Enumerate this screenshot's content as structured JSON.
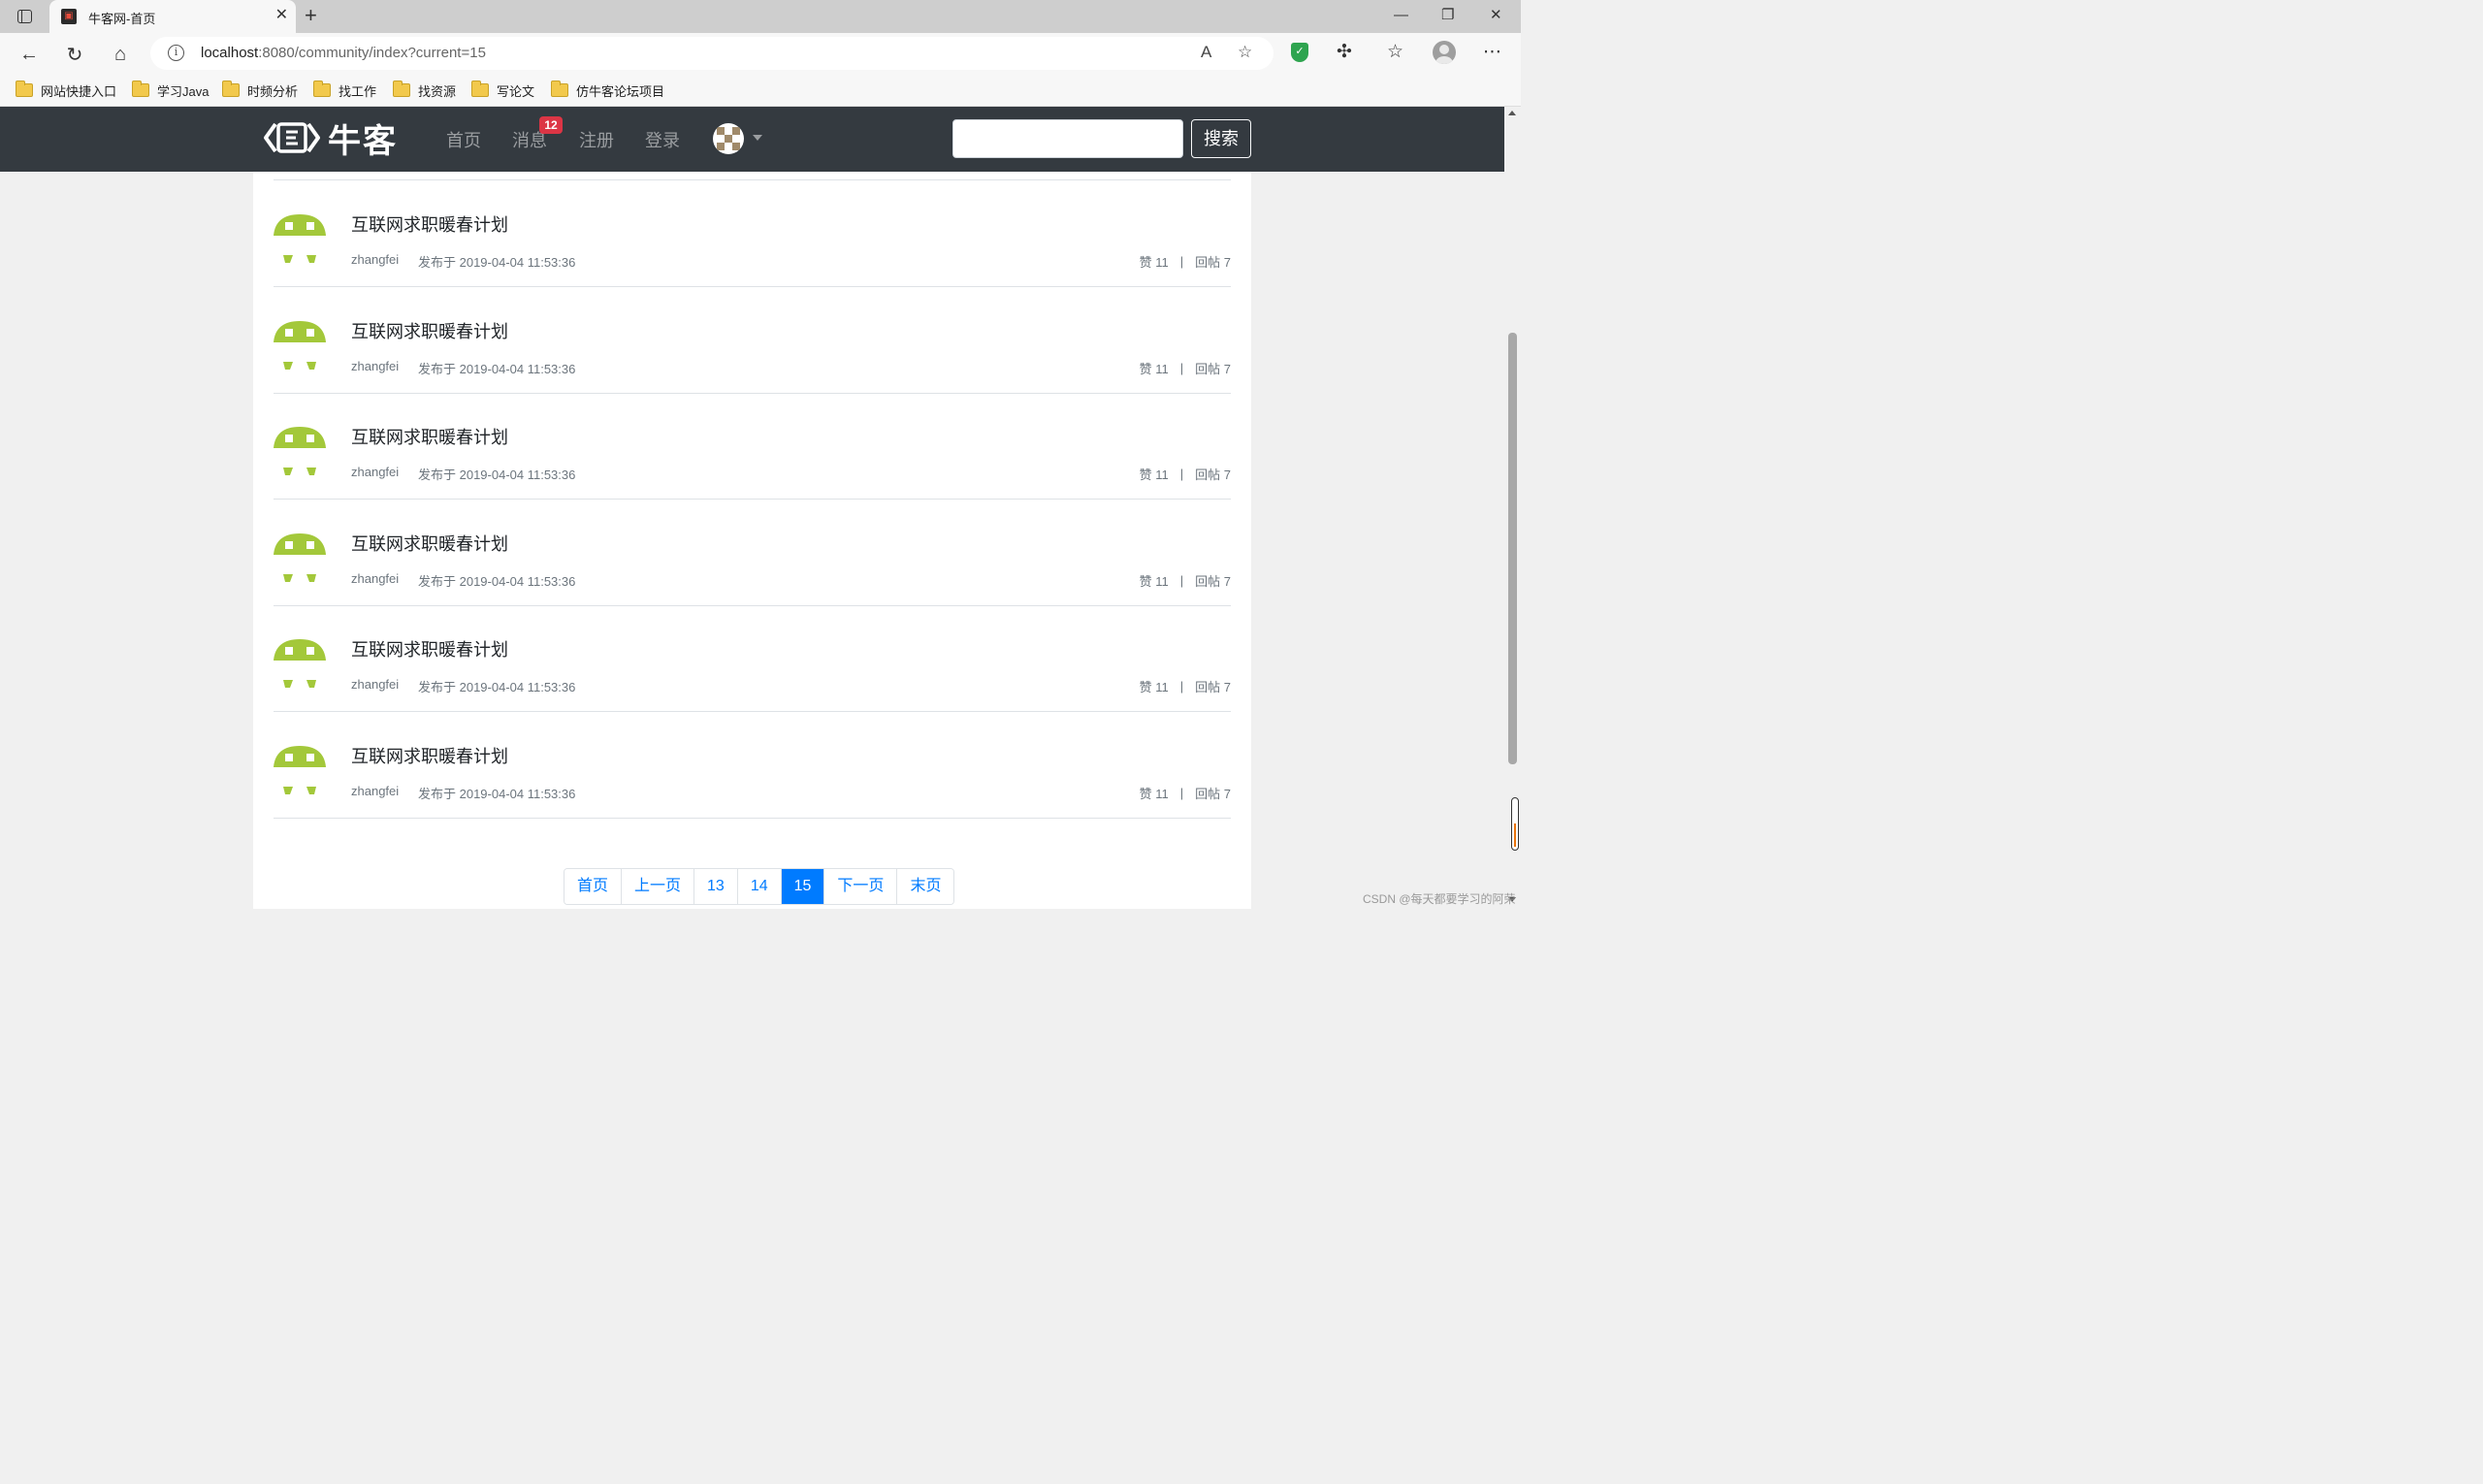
{
  "browser": {
    "tab_title": "牛客网-首页",
    "url_host": "localhost",
    "url_rest": ":8080/community/index?current=15",
    "bookmarks": [
      "网站快捷入口",
      "学习Java",
      "时频分析",
      "找工作",
      "找资源",
      "写论文",
      "仿牛客论坛项目"
    ]
  },
  "navbar": {
    "logo_text": "牛客",
    "links": [
      "首页",
      "消息",
      "注册",
      "登录"
    ],
    "message_badge": "12",
    "search_button": "搜索",
    "search_value": ""
  },
  "posts": [
    {
      "title": "互联网求职暖春计划",
      "author": "zhangfei",
      "time": "发布于 2019-04-04 11:53:36",
      "likes": "赞 11",
      "replies": "回帖 7"
    },
    {
      "title": "互联网求职暖春计划",
      "author": "zhangfei",
      "time": "发布于 2019-04-04 11:53:36",
      "likes": "赞 11",
      "replies": "回帖 7"
    },
    {
      "title": "互联网求职暖春计划",
      "author": "zhangfei",
      "time": "发布于 2019-04-04 11:53:36",
      "likes": "赞 11",
      "replies": "回帖 7"
    },
    {
      "title": "互联网求职暖春计划",
      "author": "zhangfei",
      "time": "发布于 2019-04-04 11:53:36",
      "likes": "赞 11",
      "replies": "回帖 7"
    },
    {
      "title": "互联网求职暖春计划",
      "author": "zhangfei",
      "time": "发布于 2019-04-04 11:53:36",
      "likes": "赞 11",
      "replies": "回帖 7"
    },
    {
      "title": "互联网求职暖春计划",
      "author": "zhangfei",
      "time": "发布于 2019-04-04 11:53:36",
      "likes": "赞 11",
      "replies": "回帖 7"
    }
  ],
  "stats_separator": "|",
  "pagination": [
    "首页",
    "上一页",
    "13",
    "14",
    "15",
    "下一页",
    "末页"
  ],
  "pagination_active": "15",
  "watermark": "CSDN @每天都要学习的阿荣",
  "colors": {
    "navbar_bg": "#343a40",
    "badge": "#dc3545",
    "link": "#007bff",
    "avatar_green": "#a3c83a"
  }
}
